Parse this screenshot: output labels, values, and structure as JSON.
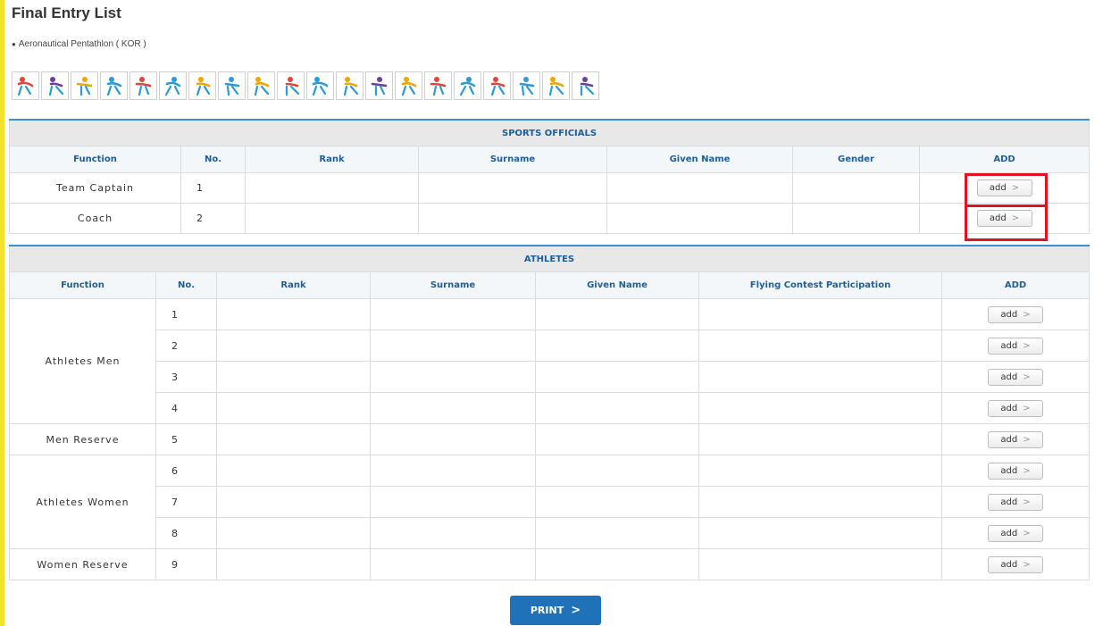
{
  "page": {
    "title": "Final Entry List",
    "subtitle": "Aeronautical Pentathlon ( KOR )",
    "print_label": "PRINT"
  },
  "sport_icons": [
    {
      "name": "shooting-icon",
      "color": "#e2453a"
    },
    {
      "name": "fencing-icon",
      "color": "#6a3fa0"
    },
    {
      "name": "orienteering-icon",
      "color": "#f0a500"
    },
    {
      "name": "cycling-icon",
      "color": "#2d9ad8"
    },
    {
      "name": "running-icon",
      "color": "#e2453a"
    },
    {
      "name": "gymnastics-icon",
      "color": "#2d9ad8"
    },
    {
      "name": "basketball-icon",
      "color": "#f0a500"
    },
    {
      "name": "swimming-icon",
      "color": "#2d9ad8"
    },
    {
      "name": "target-icon",
      "color": "#f0a500"
    },
    {
      "name": "obstacle-icon",
      "color": "#e2453a"
    },
    {
      "name": "sailing-icon",
      "color": "#2d9ad8"
    },
    {
      "name": "judo-icon",
      "color": "#f0a500"
    },
    {
      "name": "diving-icon",
      "color": "#6a3fa0"
    },
    {
      "name": "volleyball-icon",
      "color": "#f0a500"
    },
    {
      "name": "wrestling-icon",
      "color": "#e2453a"
    },
    {
      "name": "rowing-icon",
      "color": "#2d9ad8"
    },
    {
      "name": "skiing-icon",
      "color": "#e2453a"
    },
    {
      "name": "sprinting-icon",
      "color": "#2d9ad8"
    },
    {
      "name": "parachuting-icon",
      "color": "#f0a500"
    },
    {
      "name": "triathlon-icon",
      "color": "#6a3fa0"
    }
  ],
  "officials": {
    "section_title": "SPORTS OFFICIALS",
    "headers": [
      "Function",
      "No.",
      "Rank",
      "Surname",
      "Given Name",
      "Gender",
      "ADD"
    ],
    "rows": [
      {
        "function": "Team Captain",
        "no": "1",
        "add": "add"
      },
      {
        "function": "Coach",
        "no": "2",
        "add": "add"
      }
    ]
  },
  "athletes": {
    "section_title": "ATHLETES",
    "headers": [
      "Function",
      "No.",
      "Rank",
      "Surname",
      "Given Name",
      "Flying Contest Participation",
      "ADD"
    ],
    "groups": [
      {
        "function": "Athletes Men",
        "rows": [
          "1",
          "2",
          "3",
          "4"
        ]
      },
      {
        "function": "Men Reserve",
        "rows": [
          "5"
        ]
      },
      {
        "function": "Athletes Women",
        "rows": [
          "6",
          "7",
          "8"
        ]
      },
      {
        "function": "Women Reserve",
        "rows": [
          "9"
        ]
      }
    ],
    "add_label": "add"
  },
  "colors": {
    "accent_blue": "#1f72b8",
    "header_text": "#1d5f9c",
    "highlight_red": "#e0141e"
  }
}
